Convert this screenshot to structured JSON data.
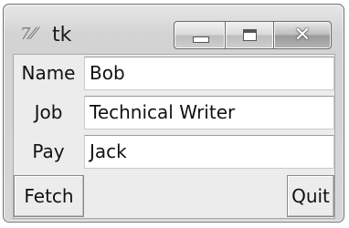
{
  "window": {
    "title": "tk",
    "icon": "tk-feather-icon",
    "controls": [
      "minimize-icon",
      "maximize-icon",
      "close-icon"
    ]
  },
  "form": {
    "rows": [
      {
        "label": "Name",
        "value": "Bob"
      },
      {
        "label": "Job",
        "value": "Technical Writer"
      },
      {
        "label": "Pay",
        "value": "Jack"
      }
    ]
  },
  "buttons": {
    "fetch": "Fetch",
    "quit": "Quit"
  },
  "close_glyph": "✕"
}
